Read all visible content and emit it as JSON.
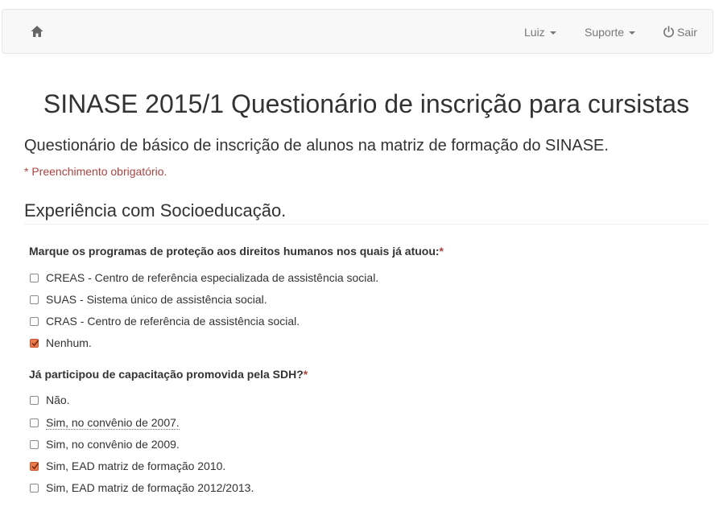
{
  "navbar": {
    "home_icon": "home-icon",
    "user_label": "Luiz",
    "support_label": "Suporte",
    "logout_label": "Sair",
    "logout_icon": "power-icon"
  },
  "page": {
    "title": "SINASE 2015/1 Questionário de inscrição para cursistas",
    "subtitle": "Questionário de básico de inscrição de alunos na matriz de formação do SINASE.",
    "required_note": "* Preenchimento obrigatório.",
    "section_title": "Experiência com Socioeducação."
  },
  "questions": [
    {
      "label": "Marque os programas de proteção aos direitos humanos nos quais já atuou:",
      "required_mark": "*",
      "options": [
        {
          "label": "CREAS - Centro de referência especializada de assistência social.",
          "checked": false
        },
        {
          "label": "SUAS - Sistema único de assistência social.",
          "checked": false
        },
        {
          "label": "CRAS - Centro de referência de assistência social.",
          "checked": false
        },
        {
          "label": "Nenhum.",
          "checked": true
        }
      ]
    },
    {
      "label": "Já participou de capacitação promovida pela SDH?",
      "required_mark": "*",
      "options": [
        {
          "label": "Não.",
          "checked": false
        },
        {
          "label": "Sim, no convênio de 2007.",
          "checked": false
        },
        {
          "label": "Sim, no convênio de 2009.",
          "checked": false
        },
        {
          "label": "Sim, EAD matriz de formação 2010.",
          "checked": true
        },
        {
          "label": "Sim, EAD matriz de formação 2012/2013.",
          "checked": false
        }
      ]
    }
  ],
  "colors": {
    "accent_check": "#ea7a4e",
    "required": "#a94442",
    "navbar_bg": "#f8f8f8"
  }
}
